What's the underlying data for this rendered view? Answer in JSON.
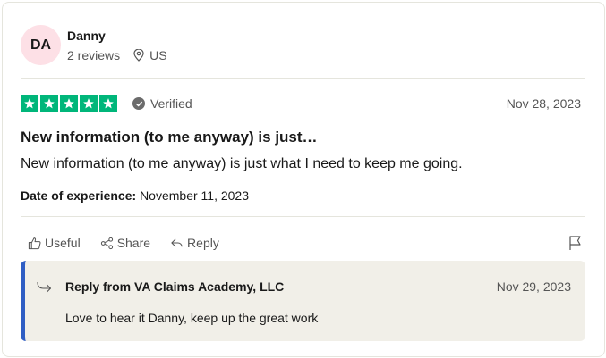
{
  "reviewer": {
    "initials": "DA",
    "name": "Danny",
    "reviews_count": "2 reviews",
    "country": "US",
    "location_icon": "location-pin-icon"
  },
  "review": {
    "stars": 5,
    "star_color": "#00b67a",
    "verified_label": "Verified",
    "date": "Nov 28, 2023",
    "title": "New information (to me anyway) is just…",
    "text": "New information (to me anyway) is just what I need to keep me going.",
    "experience_label": "Date of experience:",
    "experience_date": "November 11, 2023"
  },
  "actions": {
    "useful": "Useful",
    "share": "Share",
    "reply": "Reply"
  },
  "reply": {
    "from": "Reply from VA Claims Academy, LLC",
    "date": "Nov 29, 2023",
    "text": "Love to hear it Danny, keep up the great work",
    "accent_color": "#2f5ec4"
  }
}
